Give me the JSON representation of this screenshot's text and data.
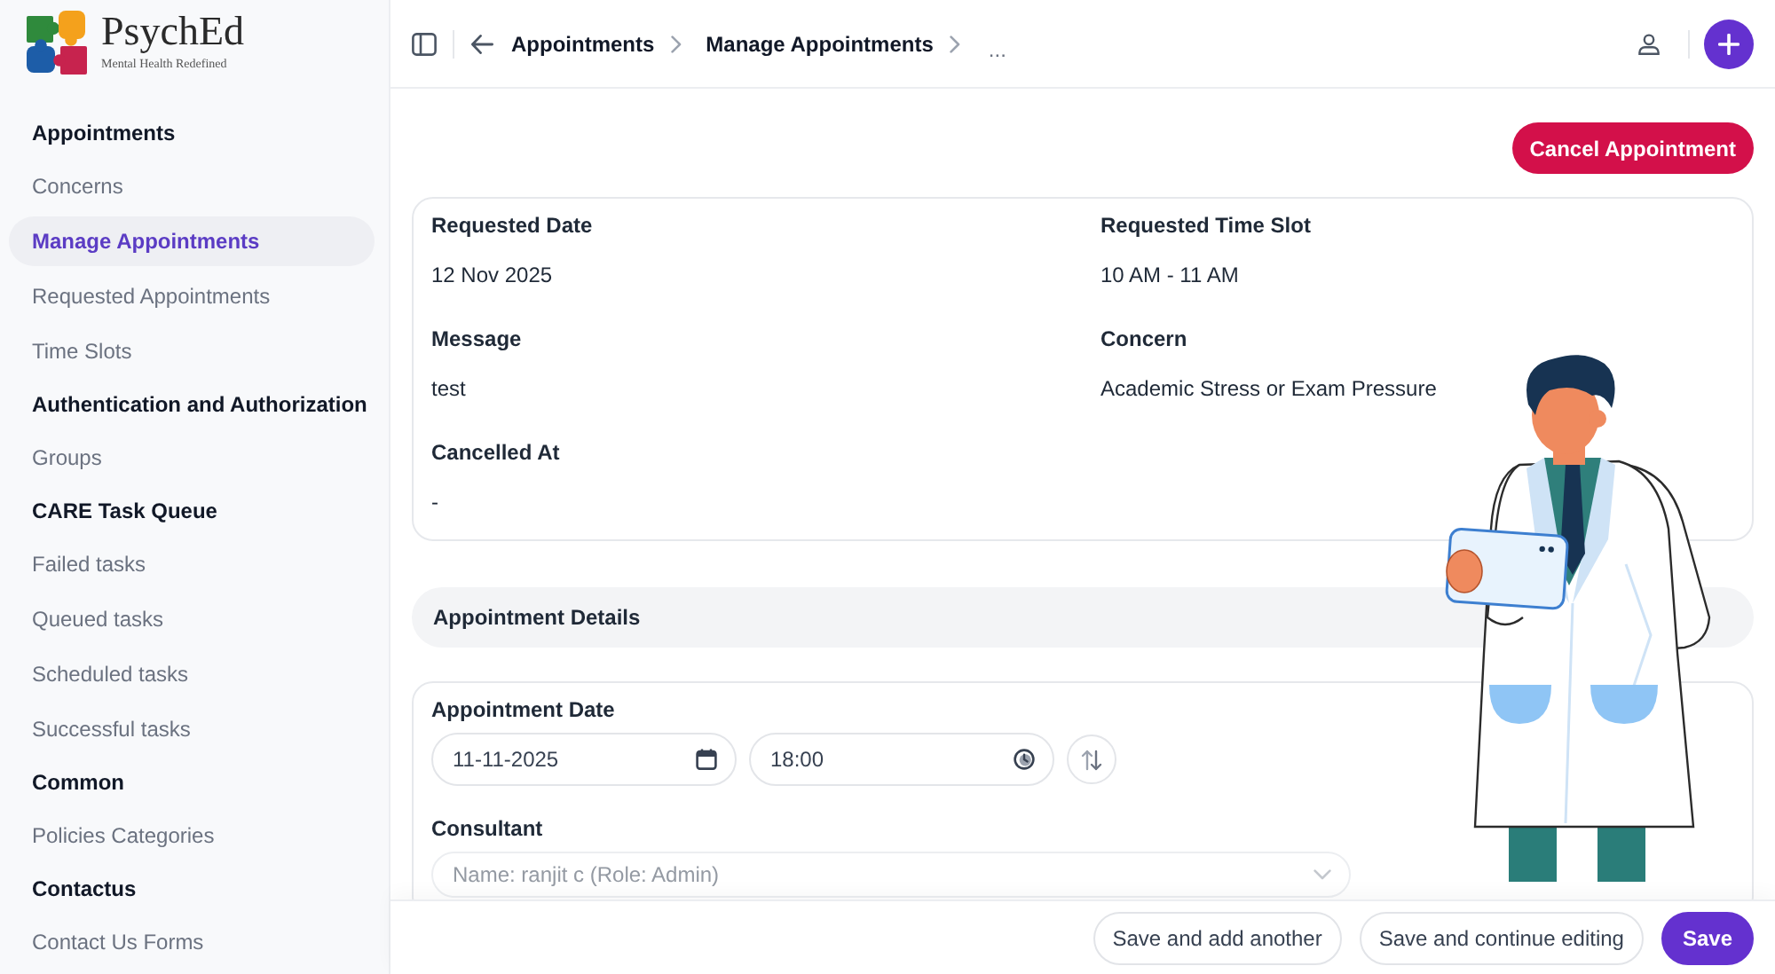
{
  "logo": {
    "name": "PsychEd",
    "tagline": "Mental Health Redefined"
  },
  "sidebar": {
    "groups": [
      {
        "title": "Appointments",
        "items": [
          {
            "label": "Concerns",
            "selected": false
          },
          {
            "label": "Manage Appointments",
            "selected": true
          },
          {
            "label": "Requested Appointments",
            "selected": false
          },
          {
            "label": "Time Slots",
            "selected": false
          }
        ]
      },
      {
        "title": "Authentication and Authorization",
        "items": [
          {
            "label": "Groups",
            "selected": false
          }
        ]
      },
      {
        "title": "CARE Task Queue",
        "items": [
          {
            "label": "Failed tasks",
            "selected": false
          },
          {
            "label": "Queued tasks",
            "selected": false
          },
          {
            "label": "Scheduled tasks",
            "selected": false
          },
          {
            "label": "Successful tasks",
            "selected": false
          }
        ]
      },
      {
        "title": "Common",
        "items": [
          {
            "label": "Policies Categories",
            "selected": false
          }
        ]
      },
      {
        "title": "Contactus",
        "items": [
          {
            "label": "Contact Us Forms",
            "selected": false
          }
        ]
      }
    ]
  },
  "topbar": {
    "breadcrumbs": [
      {
        "label": "Appointments"
      },
      {
        "label": "Manage Appointments"
      }
    ],
    "overflow": "..."
  },
  "actions": {
    "cancel": "Cancel Appointment"
  },
  "details": {
    "fields": [
      {
        "label": "Requested Date",
        "value": "12 Nov 2025"
      },
      {
        "label": "Requested Time Slot",
        "value": "10 AM - 11 AM"
      },
      {
        "label": "Message",
        "value": "test"
      },
      {
        "label": "Concern",
        "value": "Academic Stress or Exam Pressure"
      },
      {
        "label": "Cancelled At",
        "value": "-"
      }
    ]
  },
  "appointment_details": {
    "title": "Appointment Details",
    "date_field": {
      "label": "Appointment Date",
      "date": "11-11-2025",
      "time": "18:00"
    },
    "consultant_field": {
      "label": "Consultant",
      "value": "Name: ranjit c (Role: Admin)"
    }
  },
  "footer": {
    "buttons": [
      {
        "label": "Save and add another",
        "kind": "secondary"
      },
      {
        "label": "Save and continue editing",
        "kind": "secondary"
      },
      {
        "label": "Save",
        "kind": "primary"
      }
    ]
  }
}
